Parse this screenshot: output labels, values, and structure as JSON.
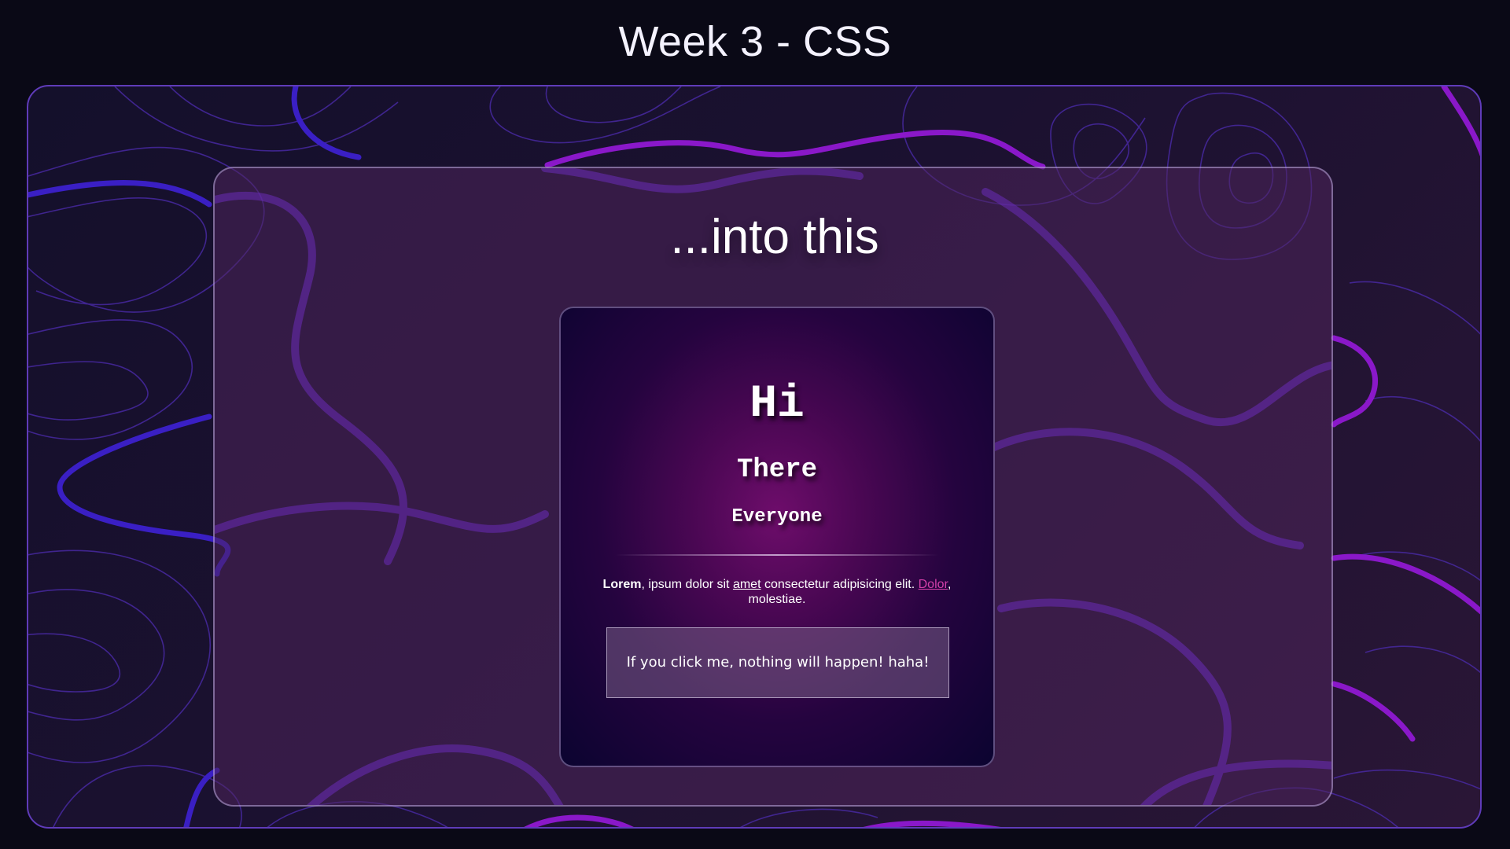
{
  "page": {
    "title": "Week 3 - CSS"
  },
  "panel": {
    "heading": "...into this"
  },
  "card": {
    "hi": "Hi",
    "there": "There",
    "everyone": "Everyone",
    "paragraph": {
      "bold": "Lorem",
      "part1": ", ipsum dolor sit ",
      "underlined": "amet",
      "part2": " consectetur adipisicing elit. ",
      "link": "Dolor",
      "part3": ", molestiae."
    },
    "button_label": "If you click me, nothing will happen! haha!"
  },
  "colors": {
    "background": "#0a0916",
    "stage_border": "#5f3bb9",
    "topo_blue": "#3a1fc4",
    "topo_purple": "#8a18c9",
    "link": "#d33fa9"
  }
}
